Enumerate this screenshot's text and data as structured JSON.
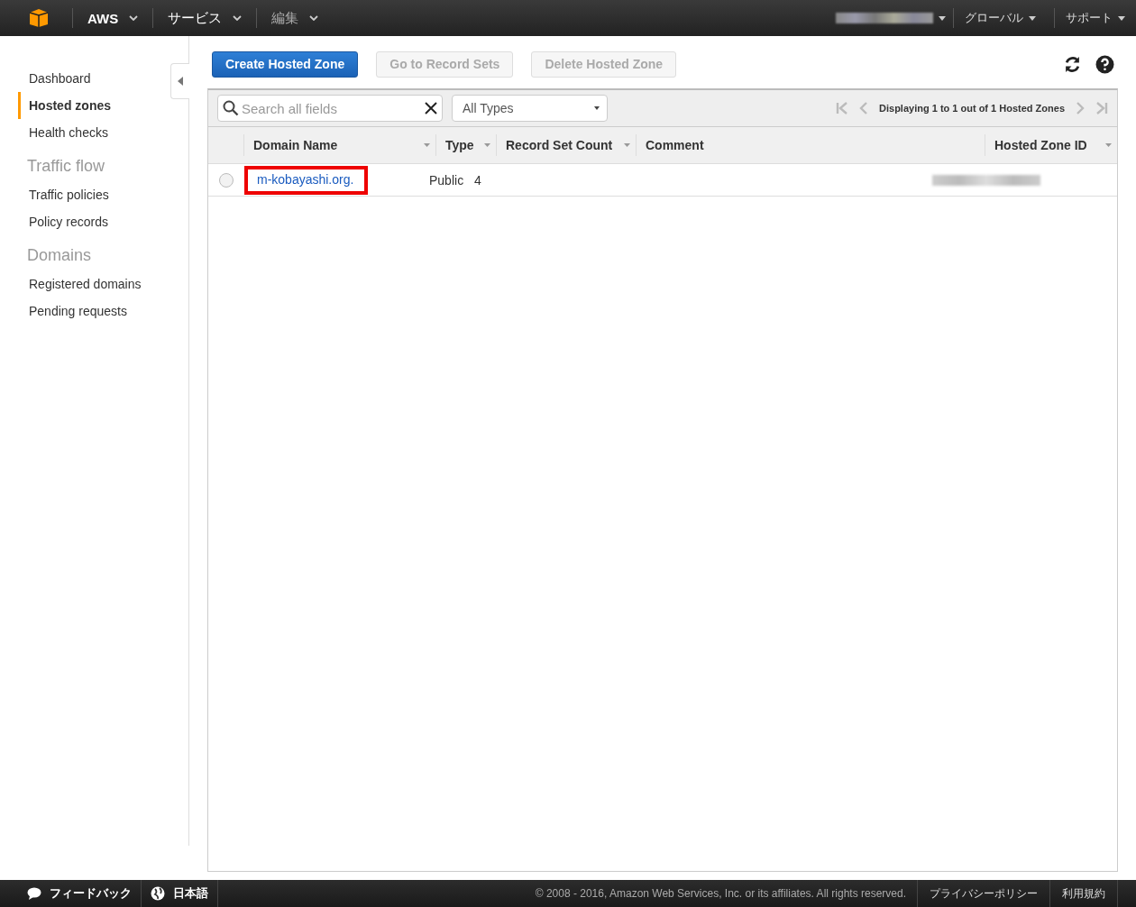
{
  "top_bar": {
    "menus": [
      {
        "label": "AWS",
        "kind": "bold"
      },
      {
        "label": "サービス",
        "kind": "normal"
      },
      {
        "label": "編集",
        "kind": "muted"
      }
    ],
    "right_menus": [
      {
        "label": "グローバル"
      },
      {
        "label": "サポート"
      }
    ]
  },
  "sidebar": {
    "items": [
      {
        "label": "Dashboard",
        "selected": false
      },
      {
        "label": "Hosted zones",
        "selected": true
      },
      {
        "label": "Health checks",
        "selected": false
      }
    ],
    "sections": [
      {
        "title": "Traffic flow",
        "items": [
          {
            "label": "Traffic policies",
            "selected": false
          },
          {
            "label": "Policy records",
            "selected": false
          }
        ]
      },
      {
        "title": "Domains",
        "items": [
          {
            "label": "Registered domains",
            "selected": false
          },
          {
            "label": "Pending requests",
            "selected": false
          }
        ]
      }
    ]
  },
  "toolbar": {
    "buttons": [
      {
        "label": "Create Hosted Zone",
        "kind": "primary",
        "disabled": false
      },
      {
        "label": "Go to Record Sets",
        "kind": "normal",
        "disabled": true
      },
      {
        "label": "Delete Hosted Zone",
        "kind": "normal",
        "disabled": true
      }
    ]
  },
  "filter": {
    "search": {
      "placeholder": "Search all fields"
    },
    "type_select": {
      "value": "All Types"
    },
    "pagination": "Displaying 1 to 1 out of 1 Hosted Zones"
  },
  "table": {
    "columns": [
      "Domain Name",
      "Type",
      "Record Set Count",
      "Comment",
      "Hosted Zone ID"
    ],
    "rows": [
      {
        "selected": false,
        "highlighted": true,
        "domain": "m-kobayashi.org.",
        "type": "Public",
        "count": "4",
        "comment": ""
      }
    ]
  },
  "footer": {
    "feedback": "フィードバック",
    "language": "日本語",
    "copyright": "© 2008 - 2016, Amazon Web Services, Inc. or its affiliates. All rights reserved.",
    "links": [
      "プライバシーポリシー",
      "利用規約"
    ]
  }
}
